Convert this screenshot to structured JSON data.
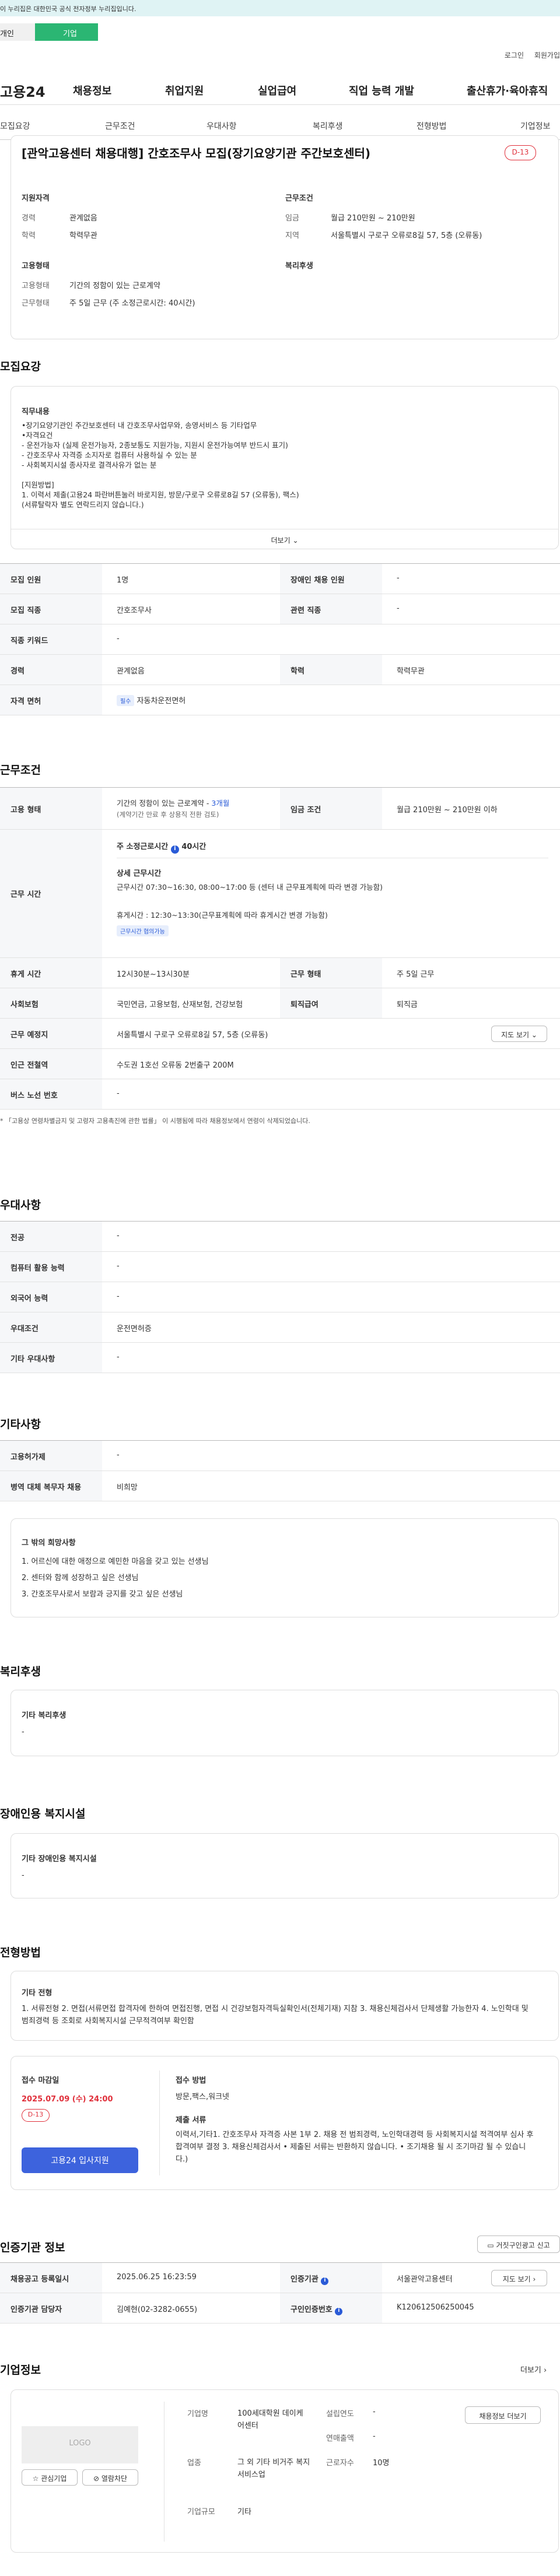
{
  "gov_banner": "이 누리집은 대한민국 공식 전자정부 누리집입니다.",
  "top_tabs": {
    "tab1": "개인",
    "tab2": "기업"
  },
  "util": {
    "login": "로그인",
    "join": "회원가입"
  },
  "gnb": {
    "logo": "고용24",
    "menu": [
      "채용정보",
      "취업지원",
      "실업급여",
      "직업 능력 개발",
      "출산휴가·육아휴직"
    ]
  },
  "lnb": [
    "모집요강",
    "근무조건",
    "우대사항",
    "복리후생",
    "전형방법",
    "기업정보"
  ],
  "header_card": {
    "title": "[관악고용센터 채용대행] 간호조무사 모집(장기요양기관 주간보호센터)",
    "dday": "D-13",
    "qual_title": "지원자격",
    "qual": [
      {
        "label": "경력",
        "value": "관계없음"
      },
      {
        "label": "학력",
        "value": "학력무관"
      }
    ],
    "cond_title": "근무조건",
    "cond": [
      {
        "label": "임금",
        "value": "월급 210만원 ~ 210만원"
      },
      {
        "label": "지역",
        "value": "서울특별시 구로구 오류로8길 57, 5층 (오류동)"
      }
    ],
    "emp_title": "고용형태",
    "emp": [
      {
        "label": "고용형태",
        "value": "기간의 정함이 있는 근로계약"
      },
      {
        "label": "근무형태",
        "value": "주 5일 근무 (주 소정근로시간: 40시간)"
      }
    ],
    "welfare_title": "복리후생"
  },
  "recruit": {
    "heading": "모집요강",
    "duty_title": "직무내용",
    "duty_text": "•장기요양기관인 주간보호센터 내 간호조무사업무와,  송영서비스 등 기타업무\n•자격요건\n - 운전가능자 (실제 운전가능자, 2종보통도 지원가능, 지원시 운전가능여부 반드시 표기)\n - 간호조무사 자격증 소지자로 컴퓨터 사용하실 수 있는 분\n - 사회복지시설 종사자로 결격사유가 없는 분\n\n[지원방법]\n1. 이력서 제출(고용24 파란버튼눌러 바로지원, 방문/구로구 오류로8길 57 (오류동), 팩스)\n(서류탈락자 별도 연락드리지 않습니다.)",
    "more_btn": "더보기",
    "rows": [
      {
        "h1": "모집 인원",
        "v1": "1명",
        "h2": "장애인 채용 인원",
        "v2": "-"
      },
      {
        "h1": "모집 직종",
        "v1": "간호조무사",
        "h2": "관련 직종",
        "v2": "-"
      },
      {
        "h1": "직종 키워드",
        "v1": "-"
      },
      {
        "h1": "경력",
        "v1": "관계없음",
        "h2": "학력",
        "v2": "학력무관"
      },
      {
        "h1": "자격 면허",
        "v1": "자동차운전면허",
        "tag": "필수"
      }
    ]
  },
  "work": {
    "heading": "근무조건",
    "emp_h": "고용 형태",
    "emp_v1": "기간의 정함이 있는 근로계약 - ",
    "emp_v1_hl": "3개월",
    "emp_v2": "(계약기간 만료 후 상용직 전환 검토)",
    "wage_h": "임금 조건",
    "wage_v": "월급 210만원 ~ 210만원 이하",
    "time_h": "근무 시간",
    "time_main": "주 소정근로시간 ",
    "time_main_hl": "40시간",
    "time_detail_title": "상세 근무시간",
    "time_detail": "근무시간 07:30~16:30, 08:00~17:00 등 (센터 내 근무표계획에 따라 변경 가능함)",
    "break_detail": "휴게시간 : 12:30~13:30(근무표계획에 따라  휴게시간 변경 가능함)",
    "time_tag": "근무시간 협의가능",
    "rows": [
      {
        "h1": "휴게 시간",
        "v1": "12시30분~13시30분",
        "h2": "근무 형태",
        "v2": "주 5일 근무"
      },
      {
        "h1": "사회보험",
        "v1": "국민연금, 고용보험, 산재보험, 건강보험",
        "h2": "퇴직급여",
        "v2": "퇴직금"
      },
      {
        "h1": "근무 예정지",
        "v1": "서울특별시 구로구 오류로8길 57, 5층 (오류동)",
        "btn": "지도 보기"
      },
      {
        "h1": "인근 전철역",
        "v1": "수도권 1호선 오류동 2번출구 200M"
      },
      {
        "h1": "버스 노선 번호",
        "v1": "-"
      }
    ],
    "note": "* 「고용상 연령차별금지 및 고령자 고용촉진에 관한 법률」 이 시행됨에 따라 채용정보에서 연령이 삭제되었습니다."
  },
  "pref": {
    "heading": "우대사항",
    "rows": [
      {
        "h": "전공",
        "v": "-"
      },
      {
        "h": "컴퓨터 활용 능력",
        "v": "-"
      },
      {
        "h": "외국어 능력",
        "v": "-"
      },
      {
        "h": "우대조건",
        "v": "운전면허증"
      },
      {
        "h": "기타 우대사항",
        "v": "-"
      }
    ]
  },
  "etc": {
    "heading": "기타사항",
    "rows": [
      {
        "h": "고용허가제",
        "v": "-"
      },
      {
        "h": "병역 대체 복무자 채용",
        "v": "비희망"
      }
    ],
    "wish_title": "그 밖의 희망사항",
    "wish": [
      "1. 어르신에 대한 애정으로 예민한 마음을 갖고 있는 선생님",
      "2. 센터와 함께 성장하고 싶은 선생님",
      "3. 간호조무사로서 보람과 긍지를 갖고 싶은 선생님"
    ]
  },
  "welfare": {
    "heading": "복리후생",
    "title": "기타 복리후생",
    "value": "-"
  },
  "disab": {
    "heading": "장애인용 복지시설",
    "title": "기타 장애인용 복지시설",
    "value": "-"
  },
  "selection": {
    "heading": "전형방법",
    "etc_title": "기타 전형",
    "etc_text": "1. 서류전형 2. 면접(서류면접 합격자에 한하여 면접진행, 면접 시 건강보험자격득실확인서(전체기재) 지참 3. 채용신체검사서 단체생활 가능한자 4. 노인학대 및 범죄경력 등 조회로 사회복지시설 근무적격여부 확인함",
    "deadline_title": "접수 마감일",
    "deadline": "2025.07.09 (수) 24:00",
    "dday": "D-13",
    "apply_btn": "고용24 입사지원",
    "method_title": "접수 방법",
    "method": "방문,팩스,워크넷",
    "docs_title": "제출 서류",
    "docs": "이력서,기타1. 간호조무사 자격증 사본 1부 2. 채용 전 범죄경력, 노인학대경력 등 사회복지시설 적격여부 심사 후 합격여부 결정 3.  채용신체검사서 • 제출된 서류는 반환하지 않습니다. • 조기채용 될 시 조기마감 될 수 있습니다.)"
  },
  "agency": {
    "heading": "인증기관 정보",
    "report_btn": "거짓구인광고 신고",
    "rows": [
      {
        "h1": "채용공고 등록일시",
        "v1": "2025.06.25 16:23:59",
        "h2": "인증기관",
        "v2": "서울관악고용센터",
        "btn": "지도 보기"
      },
      {
        "h1": "인증기관 담당자",
        "v1": "김예현(02-3282-0655)",
        "h2": "구인인증번호",
        "v2": "K120612506250045"
      }
    ]
  },
  "company": {
    "heading": "기업정보",
    "more": "더보기",
    "logo": "LOGO",
    "fav_btn": "관심기업",
    "block_btn": "열람차단",
    "fields": [
      {
        "h": "기업명",
        "v": "100세대학원 데이케어센터"
      },
      {
        "h": "업종",
        "v": "그 외 기타 비거주 복지 서비스업"
      },
      {
        "h": "기업규모",
        "v": "기타"
      }
    ],
    "fields2": [
      {
        "h": "설립연도",
        "v": "-"
      },
      {
        "h": "연매출액",
        "v": "-"
      },
      {
        "h": "근로자수",
        "v": "10명"
      }
    ],
    "jobs_btn": "채용정보 더보기"
  }
}
